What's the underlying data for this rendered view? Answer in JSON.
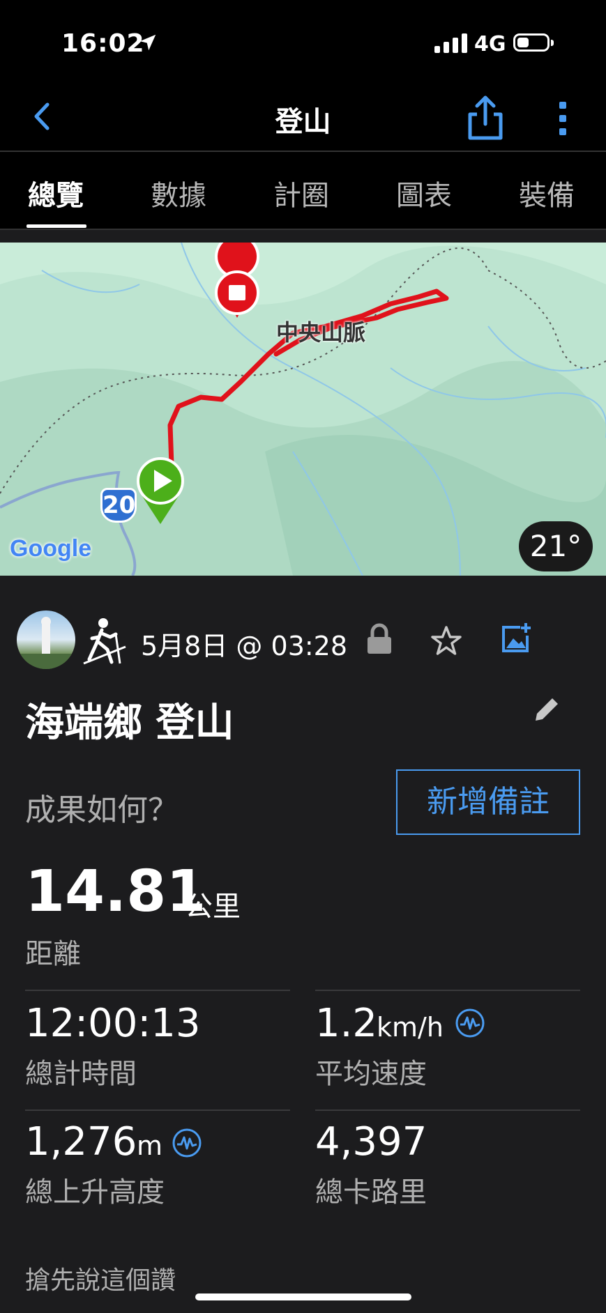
{
  "status_bar": {
    "time": "16:02",
    "network": "4G"
  },
  "header": {
    "title": "登山"
  },
  "tabs": [
    {
      "label": "總覽",
      "active": true
    },
    {
      "label": "數據",
      "active": false
    },
    {
      "label": "計圈",
      "active": false
    },
    {
      "label": "圖表",
      "active": false
    },
    {
      "label": "裝備",
      "active": false
    }
  ],
  "map": {
    "place_label": "中央山脈",
    "route_number": "20",
    "attribution": "Google",
    "temperature": "21°",
    "route_color": "#e0121b",
    "start_color": "#4caf1a",
    "end_color": "#e0121b"
  },
  "activity": {
    "datetime": "5月8日 @ 03:28",
    "title": "海端鄉 登山",
    "prompt": "成果如何？",
    "add_note_label": "新增備註"
  },
  "distance": {
    "value": "14.81",
    "unit": "公里",
    "label": "距離"
  },
  "stats": [
    {
      "value": "12:00:13",
      "unit": "",
      "label": "總計時間"
    },
    {
      "value": "1.2",
      "unit": "km/h",
      "label": "平均速度"
    },
    {
      "value": "1,276",
      "unit": "m",
      "label": "總上升高度"
    },
    {
      "value": "4,397",
      "unit": "",
      "label": "總卡路里"
    }
  ],
  "kudos_text": "搶先說這個讚",
  "colors": {
    "accent": "#4a9bf0",
    "background": "#1c1c1e",
    "bar": "#000000"
  },
  "icons": [
    "location-arrow-icon",
    "signal-icon",
    "battery-icon",
    "back-chevron-icon",
    "share-icon",
    "more-vertical-icon",
    "hiking-icon",
    "lock-icon",
    "star-icon",
    "add-photo-icon",
    "pencil-icon",
    "wave-pulse-icon"
  ]
}
